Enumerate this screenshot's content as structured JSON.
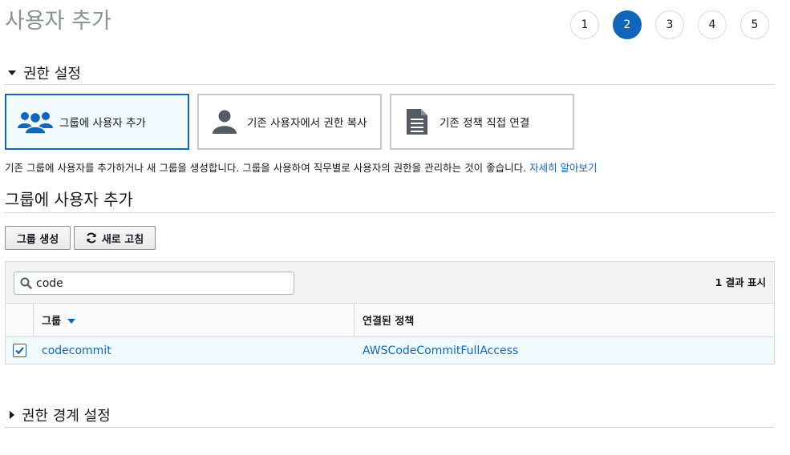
{
  "header": {
    "title": "사용자 추가"
  },
  "steps": [
    "1",
    "2",
    "3",
    "4",
    "5"
  ],
  "active_step": "2",
  "permissions": {
    "heading": "권한 설정",
    "tiles": [
      {
        "label": "그룹에 사용자 추가",
        "icon": "group-icon",
        "selected": true
      },
      {
        "label": "기존 사용자에서 권한 복사",
        "icon": "user-icon",
        "selected": false
      },
      {
        "label": "기존 정책 직접 연결",
        "icon": "document-icon",
        "selected": false
      }
    ],
    "description": "기존 그룹에 사용자를 추가하거나 새 그룹을 생성합니다. 그룹을 사용하여 직무별로 사용자의 권한을 관리하는 것이 좋습니다.",
    "learn_more": "자세히 알아보기"
  },
  "groups": {
    "heading": "그룹에 사용자 추가",
    "create_button": "그룹 생성",
    "refresh_button": "새로 고침",
    "search_value": "code",
    "result_count": "1 결과 표시",
    "columns": [
      "그룹",
      "연결된 정책"
    ],
    "rows": [
      {
        "checked": true,
        "group": "codecommit",
        "policy": "AWSCodeCommitFullAccess"
      }
    ]
  },
  "boundary": {
    "heading": "권한 경계 설정"
  },
  "colors": {
    "accent": "#1166bb",
    "border": "#d5dbdb",
    "selected_bg": "#f1faff"
  }
}
